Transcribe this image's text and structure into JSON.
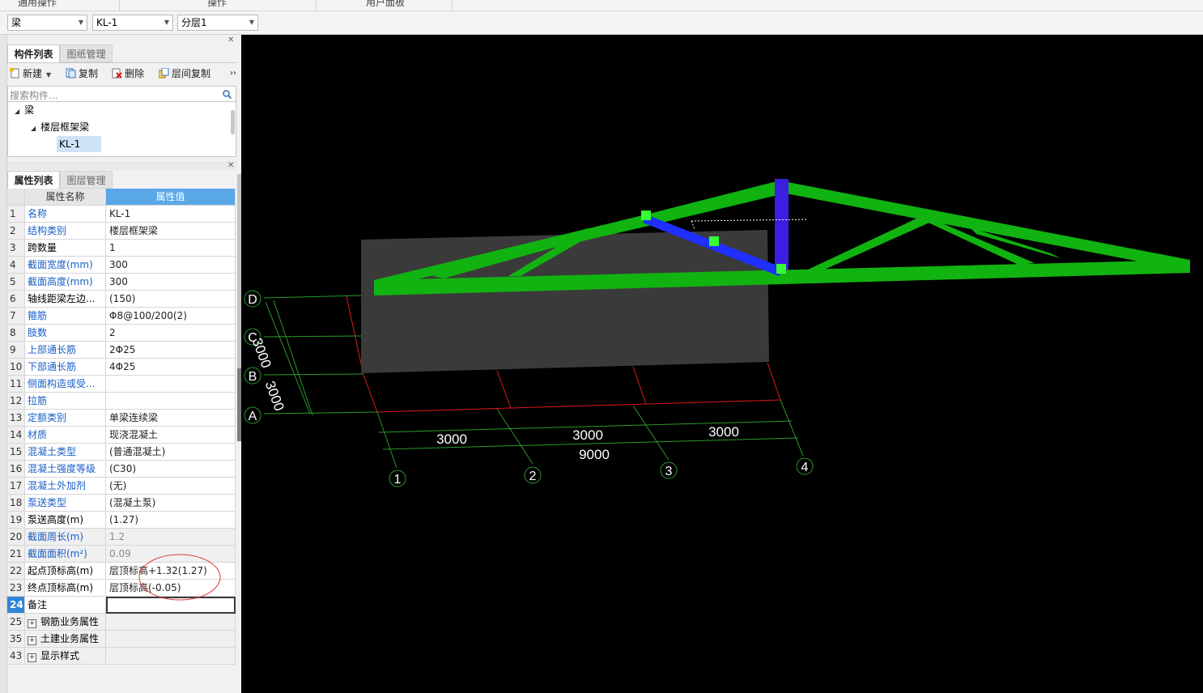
{
  "ribbon": {
    "groups": [
      "通用操作",
      "操作",
      "用户面板"
    ]
  },
  "selectors": [
    {
      "value": "梁"
    },
    {
      "value": "KL-1"
    },
    {
      "value": "分层1"
    }
  ],
  "component_panel": {
    "tabs": [
      "构件列表",
      "图纸管理"
    ],
    "toolbar": {
      "new": "新建",
      "copy": "复制",
      "delete": "删除",
      "floor_copy": "层间复制",
      "more": "››"
    },
    "search_placeholder": "搜索构件...",
    "tree": {
      "root": "梁",
      "child": "楼层框架梁",
      "leaf": "KL-1"
    }
  },
  "property_panel": {
    "tabs": [
      "属性列表",
      "图层管理"
    ],
    "header": {
      "name": "属性名称",
      "value": "属性值"
    },
    "rows": [
      {
        "idx": "1",
        "name": "名称",
        "value": "KL-1",
        "blue": true
      },
      {
        "idx": "2",
        "name": "结构类别",
        "value": "楼层框架梁",
        "blue": true
      },
      {
        "idx": "3",
        "name": "跨数量",
        "value": "1",
        "blue": false
      },
      {
        "idx": "4",
        "name": "截面宽度(mm)",
        "value": "300",
        "blue": true
      },
      {
        "idx": "5",
        "name": "截面高度(mm)",
        "value": "300",
        "blue": true
      },
      {
        "idx": "6",
        "name": "轴线距梁左边...",
        "value": "(150)",
        "blue": false
      },
      {
        "idx": "7",
        "name": "箍筋",
        "value": "Φ8@100/200(2)",
        "blue": true
      },
      {
        "idx": "8",
        "name": "肢数",
        "value": "2",
        "blue": true
      },
      {
        "idx": "9",
        "name": "上部通长筋",
        "value": "2Φ25",
        "blue": true
      },
      {
        "idx": "10",
        "name": "下部通长筋",
        "value": "4Φ25",
        "blue": true
      },
      {
        "idx": "11",
        "name": "侧面构造或受...",
        "value": "",
        "blue": true
      },
      {
        "idx": "12",
        "name": "拉筋",
        "value": "",
        "blue": true
      },
      {
        "idx": "13",
        "name": "定额类别",
        "value": "单梁连续梁",
        "blue": true
      },
      {
        "idx": "14",
        "name": "材质",
        "value": "现浇混凝土",
        "blue": true
      },
      {
        "idx": "15",
        "name": "混凝土类型",
        "value": "(普通混凝土)",
        "blue": true
      },
      {
        "idx": "16",
        "name": "混凝土强度等级",
        "value": "(C30)",
        "blue": true
      },
      {
        "idx": "17",
        "name": "混凝土外加剂",
        "value": "(无)",
        "blue": true
      },
      {
        "idx": "18",
        "name": "泵送类型",
        "value": "(混凝土泵)",
        "blue": true
      },
      {
        "idx": "19",
        "name": "泵送高度(m)",
        "value": "(1.27)",
        "blue": false
      },
      {
        "idx": "20",
        "name": "截面周长(m)",
        "value": "1.2",
        "blue": true,
        "readonly": true
      },
      {
        "idx": "21",
        "name": "截面面积(m²)",
        "value": "0.09",
        "blue": true,
        "readonly": true
      },
      {
        "idx": "22",
        "name": "起点顶标高(m)",
        "value": "层顶标高+1.32(1.27)",
        "blue": false
      },
      {
        "idx": "23",
        "name": "终点顶标高(m)",
        "value": "层顶标高(-0.05)",
        "blue": false
      },
      {
        "idx": "24",
        "name": "备注",
        "value": "",
        "blue": false,
        "selected": true
      },
      {
        "idx": "25",
        "name": "钢筋业务属性",
        "value": "",
        "group": true
      },
      {
        "idx": "35",
        "name": "土建业务属性",
        "value": "",
        "group": true
      },
      {
        "idx": "43",
        "name": "显示样式",
        "value": "",
        "group": true
      }
    ]
  },
  "viewport": {
    "axis_labels_letters": [
      "D",
      "C",
      "B",
      "A"
    ],
    "axis_labels_numbers": [
      "1",
      "2",
      "3",
      "4"
    ],
    "span_dims": [
      "3000",
      "3000",
      "3000"
    ],
    "total_dim": "9000",
    "vertical_dim_1": "3000",
    "vertical_dim_2": "3000",
    "colors": {
      "truss": "#11b311",
      "beam_blue": "#1f2fff",
      "post": "#3a1fe0",
      "slab": "#3a3a3a",
      "grid_green": "#2a9a2a",
      "grid_red": "#e01818",
      "node": "#33ff33",
      "annotation_red": "#e03a3a"
    }
  }
}
